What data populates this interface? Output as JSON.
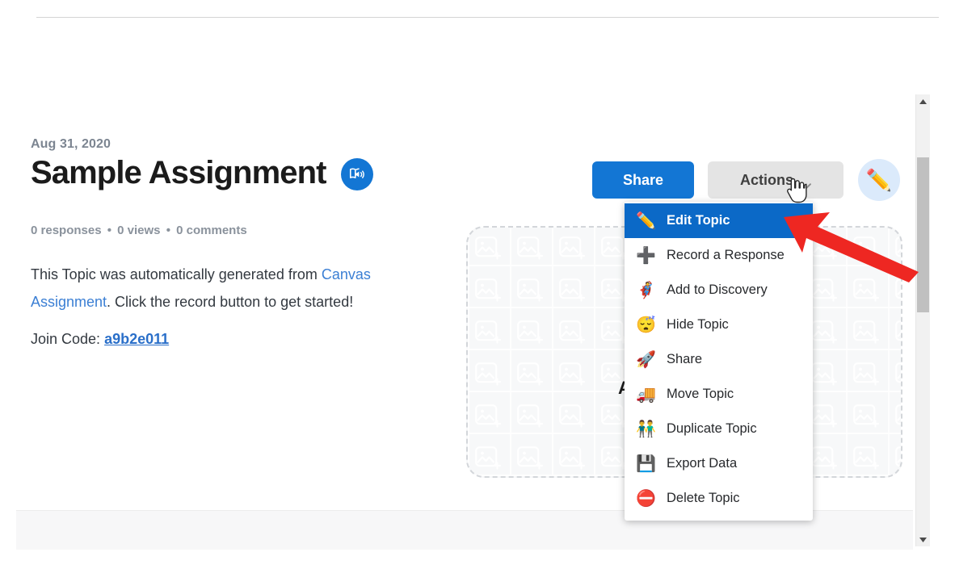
{
  "header": {
    "date": "Aug 31, 2020",
    "title": "Sample Assignment",
    "audio_icon": "book-audio-icon",
    "stats": {
      "responses": "0 responses",
      "sep1": "•",
      "views": "0 views",
      "sep2": "•",
      "comments": "0 comments"
    }
  },
  "body": {
    "paragraph_part1": "This Topic was automatically generated from ",
    "paragraph_link": "Canvas Assignment",
    "paragraph_part2": ". Click the record button to get started!",
    "join_code_label": "Join Code: ",
    "join_code_value": "a9b2e011"
  },
  "media_panel": {
    "label": "Add a Topic Media",
    "placeholder_icon": "add-image-icon"
  },
  "toolbar": {
    "share_label": "Share",
    "actions_label": "Actions",
    "caret_icon": "chevron-down-icon",
    "fab_icon": "pencil-icon",
    "fab_glyph": "✏️"
  },
  "actions_menu": {
    "items": [
      {
        "icon": "pencil-icon",
        "glyph": "✏️",
        "label": "Edit Topic",
        "active": true
      },
      {
        "icon": "plus-circle-icon",
        "glyph": "➕",
        "label": "Record a Response",
        "active": false
      },
      {
        "icon": "superhero-icon",
        "glyph": "🦸",
        "label": "Add to Discovery",
        "active": false
      },
      {
        "icon": "sleeping-face-icon",
        "glyph": "😴",
        "label": "Hide Topic",
        "active": false
      },
      {
        "icon": "rocket-icon",
        "glyph": "🚀",
        "label": "Share",
        "active": false
      },
      {
        "icon": "truck-icon",
        "glyph": "🚚",
        "label": "Move Topic",
        "active": false
      },
      {
        "icon": "two-people-icon",
        "glyph": "👬",
        "label": "Duplicate Topic",
        "active": false
      },
      {
        "icon": "floppy-disk-icon",
        "glyph": "💾",
        "label": "Export Data",
        "active": false
      },
      {
        "icon": "no-entry-icon",
        "glyph": "⛔",
        "label": "Delete Topic",
        "active": false
      }
    ]
  },
  "annotation": {
    "arrow_icon": "red-arrow-pointer",
    "arrow_color": "#ee2722",
    "cursor_icon": "pointing-hand-cursor"
  },
  "scrollbar": {
    "up_icon": "scroll-up-arrow-icon",
    "down_icon": "scroll-down-arrow-icon",
    "thumb": "scroll-thumb"
  },
  "colors": {
    "accent_blue": "#1376d4",
    "menu_highlight": "#0b69c7",
    "link_blue": "#3b7fd4",
    "muted_gray": "#8a929c",
    "annotation_red": "#ee2722"
  }
}
